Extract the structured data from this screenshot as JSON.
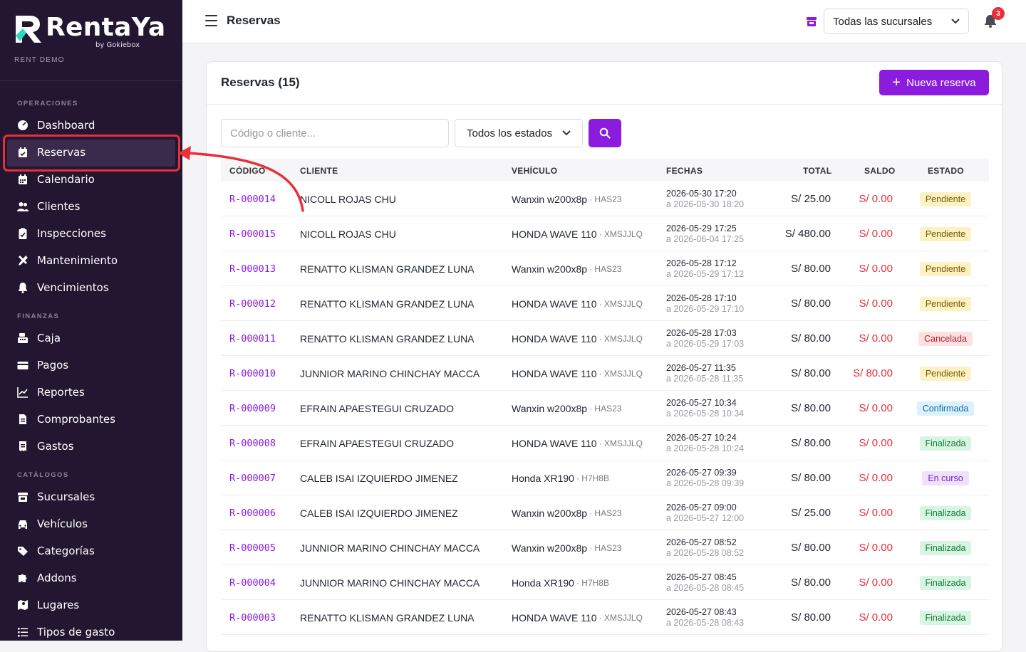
{
  "brand": {
    "name": "RentaYa",
    "by": "by Gokiebox",
    "org": "RENT DEMO"
  },
  "sidebar": {
    "sections": [
      {
        "label": "OPERACIONES",
        "items": [
          {
            "label": "Dashboard",
            "icon": "dashboard-icon"
          },
          {
            "label": "Reservas",
            "icon": "calendar-check-icon",
            "active": true
          },
          {
            "label": "Calendario",
            "icon": "calendar-icon"
          },
          {
            "label": "Clientes",
            "icon": "users-icon"
          },
          {
            "label": "Inspecciones",
            "icon": "clipboard-check-icon"
          },
          {
            "label": "Mantenimiento",
            "icon": "tools-icon"
          },
          {
            "label": "Vencimientos",
            "icon": "bell-icon"
          }
        ]
      },
      {
        "label": "FINANZAS",
        "items": [
          {
            "label": "Caja",
            "icon": "cash-register-icon"
          },
          {
            "label": "Pagos",
            "icon": "credit-card-icon"
          },
          {
            "label": "Reportes",
            "icon": "chart-line-icon"
          },
          {
            "label": "Comprobantes",
            "icon": "invoice-icon"
          },
          {
            "label": "Gastos",
            "icon": "receipt-icon"
          }
        ]
      },
      {
        "label": "CATÁLOGOS",
        "items": [
          {
            "label": "Sucursales",
            "icon": "store-icon"
          },
          {
            "label": "Vehículos",
            "icon": "car-icon"
          },
          {
            "label": "Categorías",
            "icon": "tags-icon"
          },
          {
            "label": "Addons",
            "icon": "puzzle-icon"
          },
          {
            "label": "Lugares",
            "icon": "map-icon"
          },
          {
            "label": "Tipos de gasto",
            "icon": "list-icon"
          }
        ]
      }
    ]
  },
  "topbar": {
    "title": "Reservas",
    "branch_select": "Todas las sucursales",
    "notifications": "3"
  },
  "card": {
    "title": "Reservas (15)",
    "new_button": "Nueva reserva",
    "search_placeholder": "Código o cliente...",
    "status_filter": "Todos los estados"
  },
  "table": {
    "headers": [
      "CÓDIGO",
      "CLIENTE",
      "VEHÍCULO",
      "FECHAS",
      "TOTAL",
      "SALDO",
      "ESTADO"
    ],
    "rows": [
      {
        "code": "R-000014",
        "client": "NICOLL ROJAS CHU",
        "vehicle": "Wanxin w200x8p",
        "plate": "· HAS23",
        "from": "2026-05-30 17:20",
        "to": "a 2026-05-30 18:20",
        "total": "S/ 25.00",
        "saldo": "S/ 0.00",
        "status": "Pendiente",
        "st": "pend"
      },
      {
        "code": "R-000015",
        "client": "NICOLL ROJAS CHU",
        "vehicle": "HONDA WAVE 110",
        "plate": "· XMSJJLQ",
        "from": "2026-05-29 17:25",
        "to": "a 2026-06-04 17:25",
        "total": "S/ 480.00",
        "saldo": "S/ 0.00",
        "status": "Pendiente",
        "st": "pend"
      },
      {
        "code": "R-000013",
        "client": "RENATTO KLISMAN GRANDEZ LUNA",
        "vehicle": "Wanxin w200x8p",
        "plate": "· HAS23",
        "from": "2026-05-28 17:12",
        "to": "a 2026-05-29 17:12",
        "total": "S/ 80.00",
        "saldo": "S/ 0.00",
        "status": "Pendiente",
        "st": "pend"
      },
      {
        "code": "R-000012",
        "client": "RENATTO KLISMAN GRANDEZ LUNA",
        "vehicle": "HONDA WAVE 110",
        "plate": "· XMSJJLQ",
        "from": "2026-05-28 17:10",
        "to": "a 2026-05-29 17:10",
        "total": "S/ 80.00",
        "saldo": "S/ 0.00",
        "status": "Pendiente",
        "st": "pend"
      },
      {
        "code": "R-000011",
        "client": "RENATTO KLISMAN GRANDEZ LUNA",
        "vehicle": "HONDA WAVE 110",
        "plate": "· XMSJJLQ",
        "from": "2026-05-28 17:03",
        "to": "a 2026-05-29 17:03",
        "total": "S/ 80.00",
        "saldo": "S/ 0.00",
        "status": "Cancelada",
        "st": "canc"
      },
      {
        "code": "R-000010",
        "client": "JUNNIOR MARINO CHINCHAY MACCA",
        "vehicle": "HONDA WAVE 110",
        "plate": "· XMSJJLQ",
        "from": "2026-05-27 11:35",
        "to": "a 2026-05-28 11:35",
        "total": "S/ 80.00",
        "saldo": "S/ 80.00",
        "status": "Pendiente",
        "st": "pend"
      },
      {
        "code": "R-000009",
        "client": "EFRAIN APAESTEGUI CRUZADO",
        "vehicle": "Wanxin w200x8p",
        "plate": "· HAS23",
        "from": "2026-05-27 10:34",
        "to": "a 2026-05-28 10:34",
        "total": "S/ 80.00",
        "saldo": "S/ 0.00",
        "status": "Confirmada",
        "st": "conf"
      },
      {
        "code": "R-000008",
        "client": "EFRAIN APAESTEGUI CRUZADO",
        "vehicle": "HONDA WAVE 110",
        "plate": "· XMSJJLQ",
        "from": "2026-05-27 10:24",
        "to": "a 2026-05-28 10:24",
        "total": "S/ 80.00",
        "saldo": "S/ 0.00",
        "status": "Finalizada",
        "st": "fin"
      },
      {
        "code": "R-000007",
        "client": "CALEB ISAI IZQUIERDO JIMENEZ",
        "vehicle": "Honda XR190",
        "plate": "· H7H8B",
        "from": "2026-05-27 09:39",
        "to": "a 2026-05-28 09:39",
        "total": "S/ 80.00",
        "saldo": "S/ 0.00",
        "status": "En curso",
        "st": "curso"
      },
      {
        "code": "R-000006",
        "client": "CALEB ISAI IZQUIERDO JIMENEZ",
        "vehicle": "Wanxin w200x8p",
        "plate": "· HAS23",
        "from": "2026-05-27 09:00",
        "to": "a 2026-05-27 12:00",
        "total": "S/ 25.00",
        "saldo": "S/ 0.00",
        "status": "Finalizada",
        "st": "fin"
      },
      {
        "code": "R-000005",
        "client": "JUNNIOR MARINO CHINCHAY MACCA",
        "vehicle": "Wanxin w200x8p",
        "plate": "· HAS23",
        "from": "2026-05-27 08:52",
        "to": "a 2026-05-28 08:52",
        "total": "S/ 80.00",
        "saldo": "S/ 0.00",
        "status": "Finalizada",
        "st": "fin"
      },
      {
        "code": "R-000004",
        "client": "JUNNIOR MARINO CHINCHAY MACCA",
        "vehicle": "Honda XR190",
        "plate": "· H7H8B",
        "from": "2026-05-27 08:45",
        "to": "a 2026-05-28 08:45",
        "total": "S/ 80.00",
        "saldo": "S/ 0.00",
        "status": "Finalizada",
        "st": "fin"
      },
      {
        "code": "R-000003",
        "client": "RENATTO KLISMAN GRANDEZ LUNA",
        "vehicle": "HONDA WAVE 110",
        "plate": "· XMSJJLQ",
        "from": "2026-05-27 08:43",
        "to": "a 2026-05-28 08:43",
        "total": "S/ 80.00",
        "saldo": "S/ 0.00",
        "status": "Finalizada",
        "st": "fin"
      }
    ]
  },
  "annotation": {
    "highlight_color": "#e8303a"
  },
  "colors": {
    "sidebar_bg": "#231630",
    "accent": "#8b1cdd",
    "danger": "#e0303a"
  }
}
